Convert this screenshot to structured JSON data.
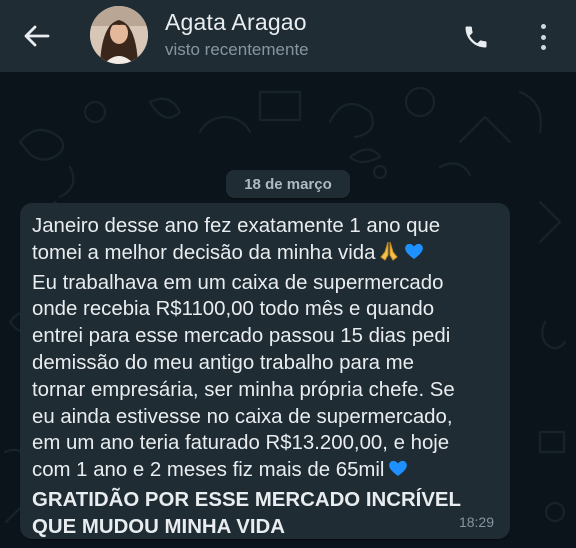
{
  "header": {
    "contact_name": "Agata Aragao",
    "status": "visto recentemente",
    "icons": [
      "back-arrow-icon",
      "avatar",
      "phone-icon",
      "more-vert-icon"
    ]
  },
  "chat": {
    "date_separator": "18 de março",
    "message": {
      "lines": [
        "Janeiro desse ano fez exatamente 1 ano que",
        "tomei a melhor decisão da minha vida",
        "Eu trabalhava em um caixa de supermercado",
        "onde recebia R$1100,00 todo mês e quando",
        "entrei para esse mercado passou 15 dias pedi",
        "demissão do meu antigo trabalho para me",
        "tornar empresária, ser minha própria chefe. Se",
        "eu ainda estivesse no caixa de supermercado,",
        "em um ano teria faturado R$13.200,00, e hoje",
        "com 1 ano e 2 meses fiz mais de 65mil",
        "GRATIDÃO POR ESSE MERCADO INCRÍVEL",
        "QUE MUDOU MINHA VIDA"
      ],
      "emojis": [
        "folded-hands-emoji",
        "blue-heart-emoji"
      ],
      "time": "18:29"
    }
  },
  "colors": {
    "header_bg": "#1f2c34",
    "chat_bg": "#0b141a",
    "bubble_bg": "#1f2c34",
    "text_primary": "#e9edef",
    "text_secondary": "#8696a0",
    "heart": "#1e90ff"
  }
}
